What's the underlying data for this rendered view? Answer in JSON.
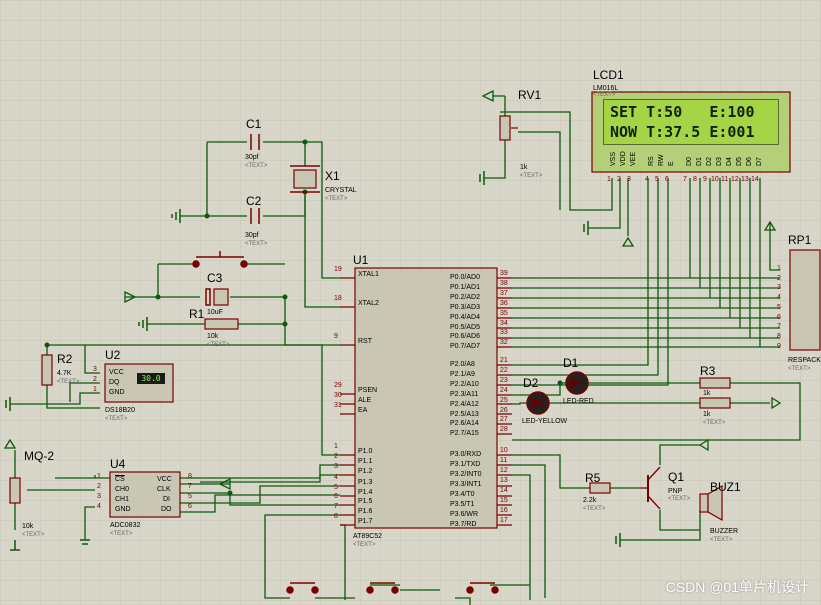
{
  "lcd": {
    "ref": "LCD1",
    "part": "LM016L",
    "line1": "SET T:50   E:100",
    "line2": "NOW T:37.5 E:001",
    "pins": [
      "VSS",
      "VDD",
      "VEE",
      "RS",
      "RW",
      "E",
      "D0",
      "D1",
      "D2",
      "D3",
      "D4",
      "D5",
      "D6",
      "D7"
    ],
    "pin_nums": [
      "1",
      "2",
      "3",
      "4",
      "5",
      "6",
      "7",
      "8",
      "9",
      "10",
      "11",
      "12",
      "13",
      "14"
    ]
  },
  "rv1": {
    "ref": "RV1",
    "value": "1k"
  },
  "c1": {
    "ref": "C1",
    "value": "30pf"
  },
  "c2": {
    "ref": "C2",
    "value": "30pf"
  },
  "x1": {
    "ref": "X1",
    "value": "CRYSTAL"
  },
  "c3": {
    "ref": "C3",
    "value": "10uF"
  },
  "r1": {
    "ref": "R1",
    "value": "10k"
  },
  "r2": {
    "ref": "R2",
    "value": "4.7K"
  },
  "u2": {
    "ref": "U2",
    "part": "DS18B20",
    "display": "30.0",
    "pins": [
      "VCC",
      "DQ",
      "GND"
    ],
    "pin_nums": [
      "3",
      "2",
      "1"
    ]
  },
  "mq2": {
    "ref": "MQ-2",
    "value": "10k"
  },
  "u4": {
    "ref": "U4",
    "part": "ADC0832",
    "left_pins": [
      "CS",
      "CH0",
      "CH1",
      "GND"
    ],
    "left_nums": [
      "1",
      "2",
      "3",
      "4"
    ],
    "right_pins": [
      "VCC",
      "CLK",
      "DI",
      "DO"
    ],
    "right_nums": [
      "8",
      "7",
      "5",
      "6"
    ]
  },
  "u1": {
    "ref": "U1",
    "part": "AT89C52",
    "left": [
      {
        "n": "19",
        "p": "XTAL1"
      },
      {
        "n": "18",
        "p": "XTAL2"
      },
      {
        "n": "9",
        "p": "RST"
      },
      {
        "n": "29",
        "p": "PSEN"
      },
      {
        "n": "30",
        "p": "ALE"
      },
      {
        "n": "31",
        "p": "EA"
      },
      {
        "n": "1",
        "p": "P1.0"
      },
      {
        "n": "2",
        "p": "P1.1"
      },
      {
        "n": "3",
        "p": "P1.2"
      },
      {
        "n": "4",
        "p": "P1.3"
      },
      {
        "n": "5",
        "p": "P1.4"
      },
      {
        "n": "6",
        "p": "P1.5"
      },
      {
        "n": "7",
        "p": "P1.6"
      },
      {
        "n": "8",
        "p": "P1.7"
      }
    ],
    "right_p0": [
      {
        "n": "39",
        "p": "P0.0/AD0"
      },
      {
        "n": "38",
        "p": "P0.1/AD1"
      },
      {
        "n": "37",
        "p": "P0.2/AD2"
      },
      {
        "n": "36",
        "p": "P0.3/AD3"
      },
      {
        "n": "35",
        "p": "P0.4/AD4"
      },
      {
        "n": "34",
        "p": "P0.5/AD5"
      },
      {
        "n": "33",
        "p": "P0.6/AD6"
      },
      {
        "n": "32",
        "p": "P0.7/AD7"
      }
    ],
    "right_p2": [
      {
        "n": "21",
        "p": "P2.0/A8"
      },
      {
        "n": "22",
        "p": "P2.1/A9"
      },
      {
        "n": "23",
        "p": "P2.2/A10"
      },
      {
        "n": "24",
        "p": "P2.3/A11"
      },
      {
        "n": "25",
        "p": "P2.4/A12"
      },
      {
        "n": "26",
        "p": "P2.5/A13"
      },
      {
        "n": "27",
        "p": "P2.6/A14"
      },
      {
        "n": "28",
        "p": "P2.7/A15"
      }
    ],
    "right_p3": [
      {
        "n": "10",
        "p": "P3.0/RXD"
      },
      {
        "n": "11",
        "p": "P3.1/TXD"
      },
      {
        "n": "12",
        "p": "P3.2/INT0"
      },
      {
        "n": "13",
        "p": "P3.3/INT1"
      },
      {
        "n": "14",
        "p": "P3.4/T0"
      },
      {
        "n": "15",
        "p": "P3.5/T1"
      },
      {
        "n": "16",
        "p": "P3.6/WR"
      },
      {
        "n": "17",
        "p": "P3.7/RD"
      }
    ]
  },
  "rp1": {
    "ref": "RP1",
    "part": "RESPACK-8",
    "nums": [
      "1",
      "2",
      "3",
      "4",
      "5",
      "6",
      "7",
      "8",
      "9"
    ]
  },
  "d1": {
    "ref": "D1",
    "part": "LED-RED"
  },
  "d2": {
    "ref": "D2",
    "part": "LED-YELLOW"
  },
  "r3": {
    "ref": "R3",
    "value": "1k"
  },
  "r4": {
    "value": "1k"
  },
  "r5": {
    "ref": "R5",
    "value": "2.2k"
  },
  "q1": {
    "ref": "Q1",
    "part": "PNP"
  },
  "buz1": {
    "ref": "BUZ1",
    "part": "BUZZER"
  },
  "text_tag": "<TEXT>",
  "watermark": "CSDN @01单片机设计",
  "colors": {
    "background": "#d8d6c8",
    "wire": "#0b5a0b",
    "component": "#7a0000",
    "chip_fill": "#c9c7b4",
    "lcd_fill": "#a6d447"
  }
}
